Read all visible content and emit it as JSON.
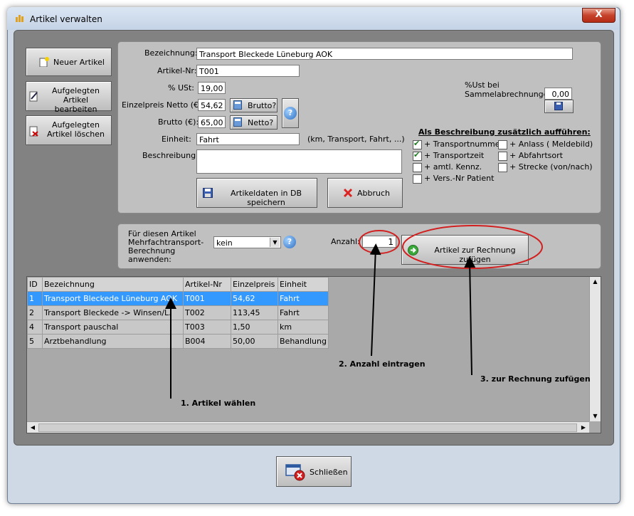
{
  "window": {
    "title": "Artikel verwalten",
    "close_label": "X"
  },
  "side_buttons": {
    "new": "Neuer Artikel",
    "edit": "Aufgelegten Artikel bearbeiten",
    "delete": "Aufgelegten Artikel löschen"
  },
  "form": {
    "bezeichnung_label": "Bezeichnung:",
    "bezeichnung_value": "Transport Bleckede Lüneburg AOK",
    "artikelnr_label": "Artikel-Nr:",
    "artikelnr_value": "T001",
    "ust_label": "% USt:",
    "ust_value": "19,00",
    "netto_label": "Einzelpreis Netto (€):",
    "netto_value": "54,62",
    "brutto_btn": "Brutto?",
    "brutto_label": "Brutto (€):",
    "brutto_value": "65,00",
    "netto_btn": "Netto?",
    "einheit_label": "Einheit:",
    "einheit_value": "Fahrt",
    "einheit_hint": "(km, Transport, Fahrt, ...)",
    "beschreibung_label": "Beschreibung:",
    "beschreibung_value": "",
    "save_btn": "Artikeldaten in DB speichern",
    "abort_btn": "Abbruch",
    "sammel_label": "%Ust bei Sammelabrechnungen:",
    "sammel_value": "0,00"
  },
  "options": {
    "heading": "Als Beschreibung zusätzlich aufführen:",
    "left": [
      {
        "label": "+ Transportnummer",
        "checked": true
      },
      {
        "label": "+ Transportzeit",
        "checked": true
      },
      {
        "label": "+ amtl. Kennz.",
        "checked": false
      },
      {
        "label": "+ Vers.-Nr Patient",
        "checked": false
      }
    ],
    "right": [
      {
        "label": "+ Anlass ( Meldebild)",
        "checked": false
      },
      {
        "label": "+ Abfahrtsort",
        "checked": false
      },
      {
        "label": "+ Strecke (von/nach)",
        "checked": false
      }
    ]
  },
  "calc": {
    "label": "Für diesen Artikel Mehrfachtransport-Berechnung anwenden:",
    "select_value": "kein",
    "anzahl_label": "Anzahl:",
    "anzahl_value": "1",
    "add_btn": "Artikel zur Rechnung zufügen"
  },
  "table": {
    "headers": [
      "ID",
      "Bezeichnung",
      "Artikel-Nr",
      "Einzelpreis",
      "Einheit"
    ],
    "rows": [
      [
        "1",
        "Transport Bleckede Lüneburg AOK",
        "T001",
        "54,62",
        "Fahrt"
      ],
      [
        "2",
        "Transport Bleckede -> Winsen/L.",
        "T002",
        "113,45",
        "Fahrt"
      ],
      [
        "4",
        "Transport pauschal",
        "T003",
        "1,50",
        "km"
      ],
      [
        "5",
        "Arztbehandlung",
        "B004",
        "50,00",
        "Behandlung"
      ]
    ]
  },
  "annotations": {
    "step1": "1. Artikel wählen",
    "step2": "2. Anzahl eintragen",
    "step3": "3. zur Rechnung zufügen"
  },
  "footer": {
    "close_btn": "Schließen"
  },
  "colors": {
    "selection": "#3399ff",
    "annotation_red": "#d21f1f",
    "checkmark": "#1f7a1f"
  }
}
